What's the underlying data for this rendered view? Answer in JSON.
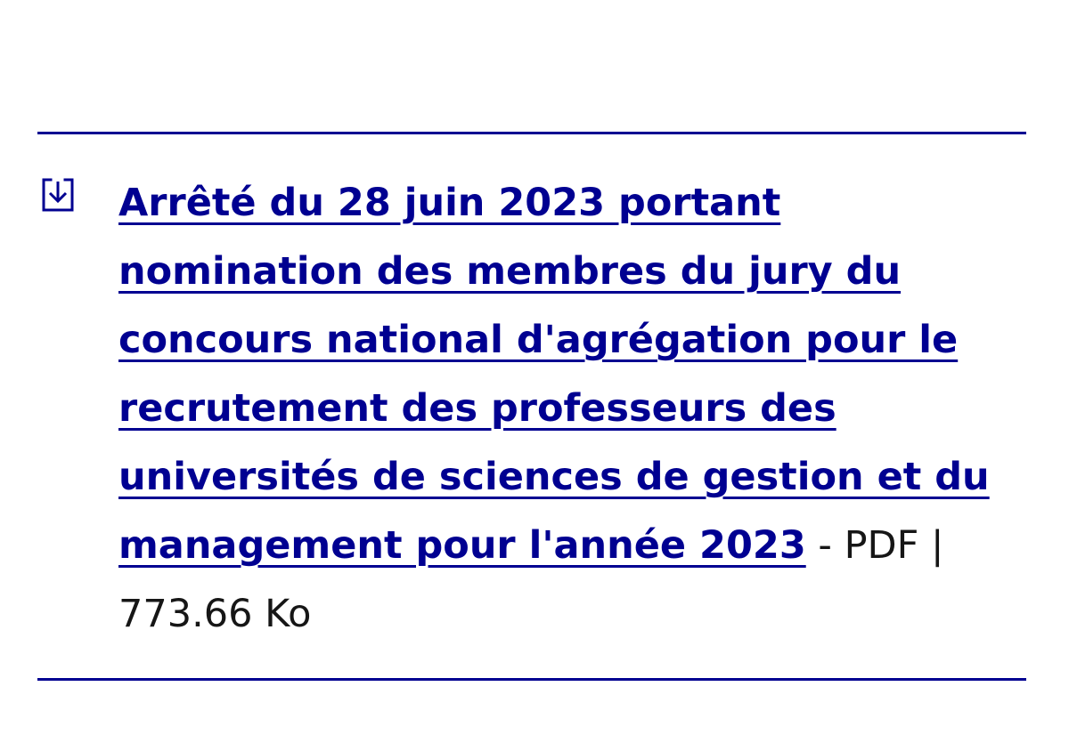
{
  "download": {
    "icon": "download-icon",
    "link_text": "Arrêté du 28 juin 2023 portant nomination des membres du jury du concours national d'agrégation pour le recrutement des professeurs des universités de sciences de gestion et du management pour l'année 2023",
    "separator": " - ",
    "file_type": "PDF",
    "size_separator": " | ",
    "file_size": "773.66 Ko"
  },
  "colors": {
    "accent": "#000091",
    "text": "#161616",
    "background": "#ffffff"
  }
}
